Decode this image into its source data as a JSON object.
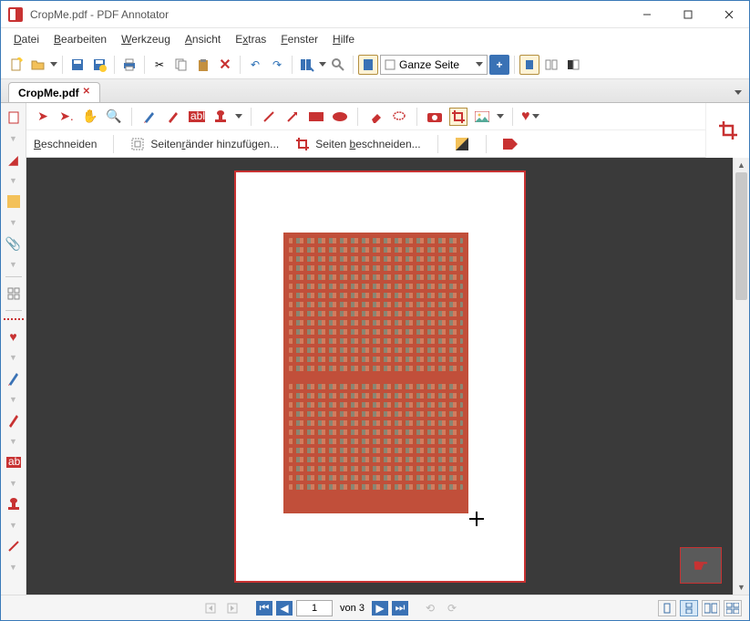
{
  "window": {
    "title": "CropMe.pdf - PDF Annotator"
  },
  "menu": {
    "file": "Datei",
    "edit": "Bearbeiten",
    "tool": "Werkzeug",
    "view": "Ansicht",
    "extras": "Extras",
    "window": "Fenster",
    "help": "Hilfe"
  },
  "tab": {
    "label": "CropMe.pdf"
  },
  "zoom": {
    "label": "Ganze Seite"
  },
  "cropbar": {
    "crop": "Beschneiden",
    "add_margins": "Seitenränder hinzufügen...",
    "crop_pages": "Seiten beschneiden..."
  },
  "status": {
    "page_value": "1",
    "page_of": "von 3"
  }
}
